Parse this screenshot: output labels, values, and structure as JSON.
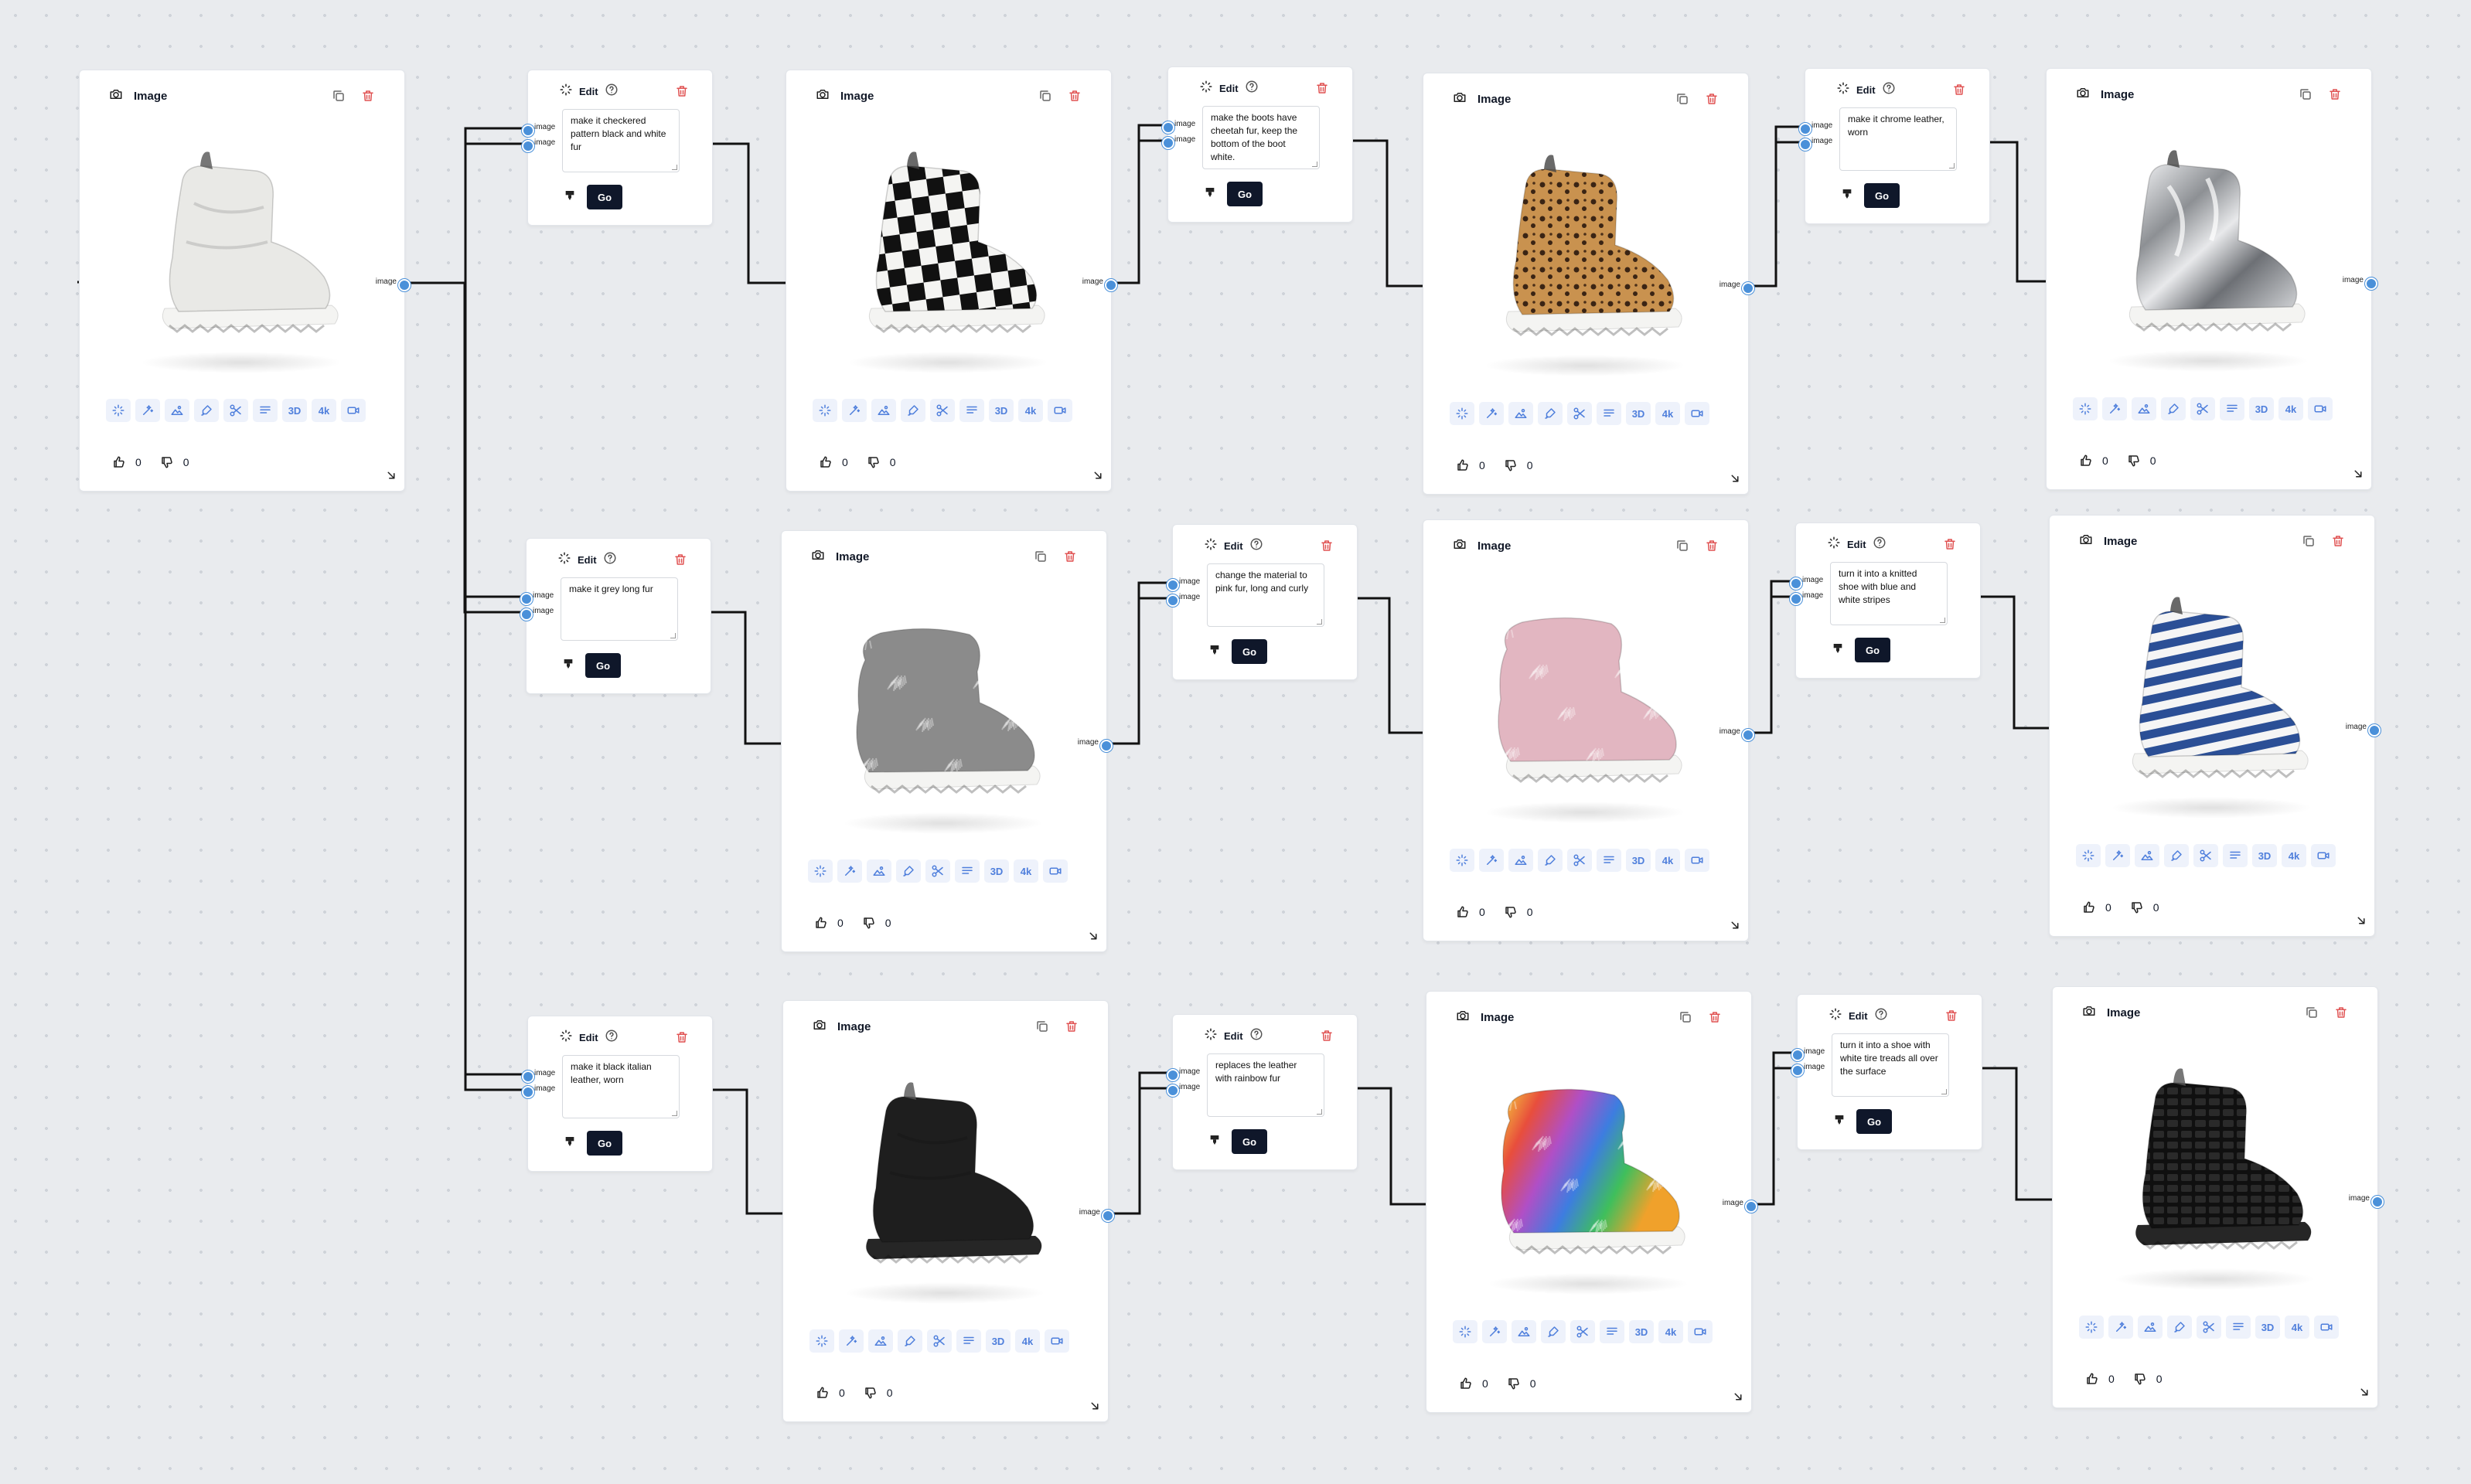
{
  "image_node_title": "Image",
  "edit_node_title": "Edit",
  "port_label": "image",
  "go_label": "Go",
  "vote_likes": "0",
  "vote_dislikes": "0",
  "toolbar_tools": [
    "sparkle-icon",
    "magic-wand-icon",
    "landscape-icon",
    "brush-icon",
    "scissors-icon",
    "text-lines-icon",
    "3D",
    "4k",
    "video-icon"
  ],
  "colors": {
    "accent_blue": "#4a90d9",
    "tool_bg": "#eef2fb",
    "go_bg": "#0f172a",
    "delete_red": "#e05252"
  },
  "images": [
    {
      "id": "orig",
      "desc": "white leather boot",
      "color": "#e9e9e6",
      "pattern": "plain"
    },
    {
      "id": "checker",
      "desc": "checkered fur boot",
      "color": "#111111",
      "pattern": "checker"
    },
    {
      "id": "cheetah",
      "desc": "cheetah fur boot",
      "color": "#c08b48",
      "pattern": "spots"
    },
    {
      "id": "chrome",
      "desc": "chrome boot",
      "color": "#c4c6c9",
      "pattern": "chrome"
    },
    {
      "id": "grey",
      "desc": "grey long fur boot",
      "color": "#8b8b8b",
      "pattern": "fur"
    },
    {
      "id": "pink",
      "desc": "pink curly fur boot",
      "color": "#e2b6c1",
      "pattern": "fur"
    },
    {
      "id": "knit",
      "desc": "striped knit boot",
      "color": "#2b4f96",
      "pattern": "stripes"
    },
    {
      "id": "black",
      "desc": "black leather boot",
      "color": "#1e1e1e",
      "pattern": "plain"
    },
    {
      "id": "rainbow",
      "desc": "rainbow fur boot",
      "color": "#e84e3c",
      "pattern": "rainbow"
    },
    {
      "id": "tire",
      "desc": "tire tread boot",
      "color": "#151515",
      "pattern": "tread"
    }
  ],
  "edits": [
    {
      "prompt": "make it checkered pattern black and white fur"
    },
    {
      "prompt": "make the boots have cheetah fur, keep the bottom of the boot white."
    },
    {
      "prompt": "make it chrome leather, worn"
    },
    {
      "prompt": "make it grey long fur"
    },
    {
      "prompt": "change the material to pink fur, long and curly"
    },
    {
      "prompt": "turn it into a knitted shoe with blue and white stripes"
    },
    {
      "prompt": "make it black italian leather, worn"
    },
    {
      "prompt": "replaces the leather with rainbow fur"
    },
    {
      "prompt": "turn it into a shoe with white tire treads all over the surface"
    }
  ]
}
